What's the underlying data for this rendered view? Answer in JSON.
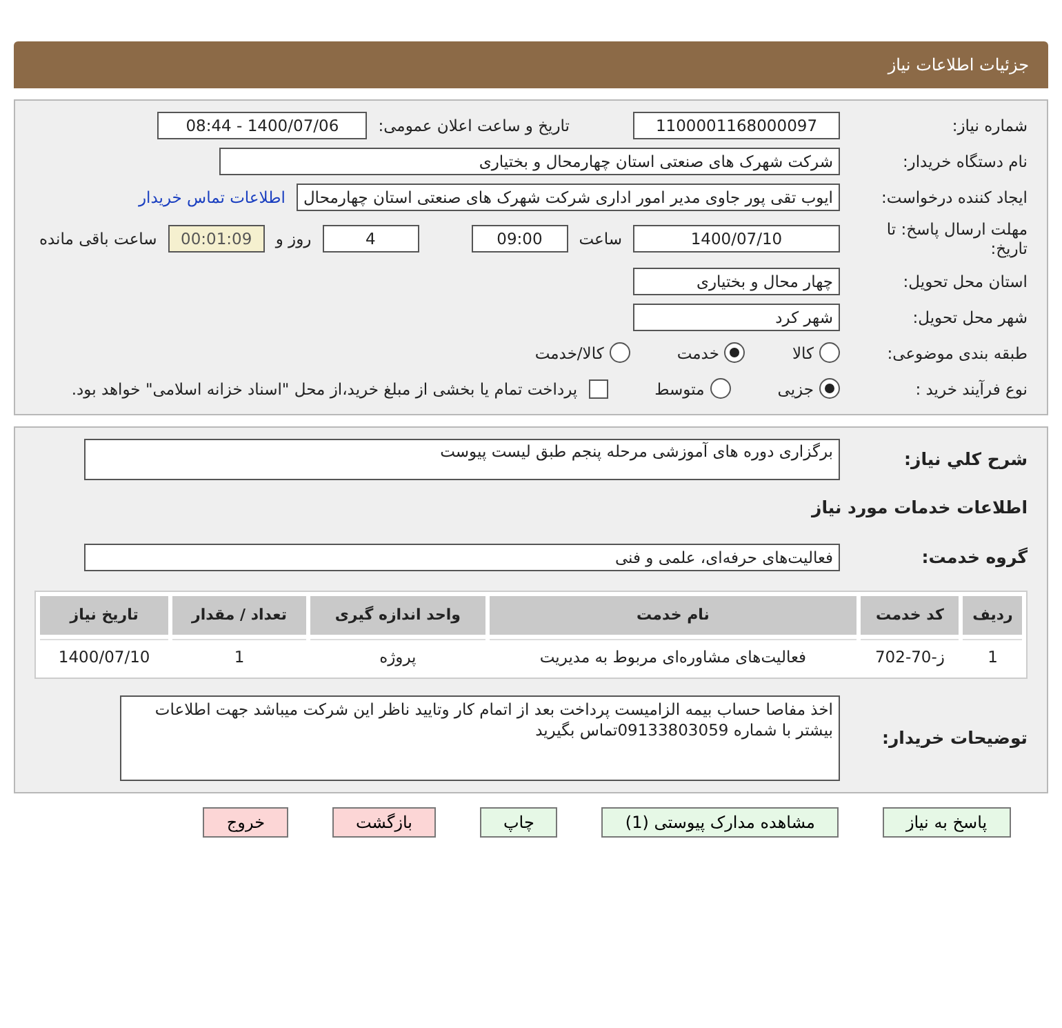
{
  "header": {
    "title": "جزئیات اطلاعات نیاز"
  },
  "details": {
    "need_number": {
      "label": "شماره نیاز:",
      "value": "1100001168000097"
    },
    "announce": {
      "label": "تاریخ و ساعت اعلان عمومی:",
      "value": "1400/07/06 - 08:44"
    },
    "buyer_org": {
      "label": "نام دستگاه خریدار:",
      "value": "شرکت شهرک های صنعتی استان چهارمحال و بختیاری"
    },
    "requester": {
      "label": "ایجاد کننده درخواست:",
      "value": "ایوب تقی پور جاوی مدیر امور اداری شرکت شهرک های صنعتی استان چهارمحال",
      "link": "اطلاعات تماس خریدار"
    },
    "deadline": {
      "label": "مهلت ارسال پاسخ: تا تاریخ:",
      "date": "1400/07/10",
      "time_label": "ساعت",
      "time": "09:00",
      "days": "4",
      "days_label": "روز و",
      "remaining": "00:01:09",
      "remaining_label": "ساعت باقی مانده"
    },
    "province": {
      "label": "استان محل تحویل:",
      "value": "چهار محال و بختیاری"
    },
    "city": {
      "label": "شهر محل تحویل:",
      "value": "شهر کرد"
    },
    "category": {
      "label": "طبقه بندی موضوعی:",
      "options": [
        {
          "label": "کالا",
          "selected": false
        },
        {
          "label": "خدمت",
          "selected": true
        },
        {
          "label": "کالا/خدمت",
          "selected": false
        }
      ]
    },
    "purchase_type": {
      "label": "نوع فرآیند خرید :",
      "options": [
        {
          "label": "جزیی",
          "selected": true
        },
        {
          "label": "متوسط",
          "selected": false
        }
      ],
      "payment": {
        "checked": false,
        "text": "پرداخت تمام یا بخشی از مبلغ خرید،از محل \"اسناد خزانه اسلامی\" خواهد بود."
      }
    }
  },
  "summary": {
    "label": "شرح کلي نياز:",
    "value": "برگزاری دوره های آموزشی مرحله پنجم طبق لیست پیوست"
  },
  "services_title": "اطلاعات خدمات مورد نیاز",
  "service_group": {
    "label": "گروه خدمت:",
    "value": "فعالیت‌های حرفه‌ای، علمی و فنی"
  },
  "table": {
    "columns": [
      "ردیف",
      "کد خدمت",
      "نام خدمت",
      "واحد اندازه گیری",
      "تعداد / مقدار",
      "تاریخ نیاز"
    ],
    "rows": [
      [
        "1",
        "ز-70-702",
        "فعالیت‌های مشاوره‌ای مربوط به مدیریت",
        "پروژه",
        "1",
        "1400/07/10"
      ]
    ]
  },
  "buyer_notes": {
    "label": "توضیحات خریدار:",
    "value": "اخذ مفاصا حساب بیمه الزامیست پرداخت بعد از اتمام کار  وتایید ناظر این شرکت میباشد جهت اطلاعات بیشتر با شماره 09133803059تماس بگیرید"
  },
  "buttons": [
    {
      "label": "پاسخ به نیاز",
      "kind": "normal"
    },
    {
      "label": "مشاهده مدارک پیوستی (1)",
      "kind": "normal"
    },
    {
      "label": "چاپ",
      "kind": "normal"
    },
    {
      "label": "بازگشت",
      "kind": "danger"
    },
    {
      "label": "خروج",
      "kind": "danger"
    }
  ]
}
